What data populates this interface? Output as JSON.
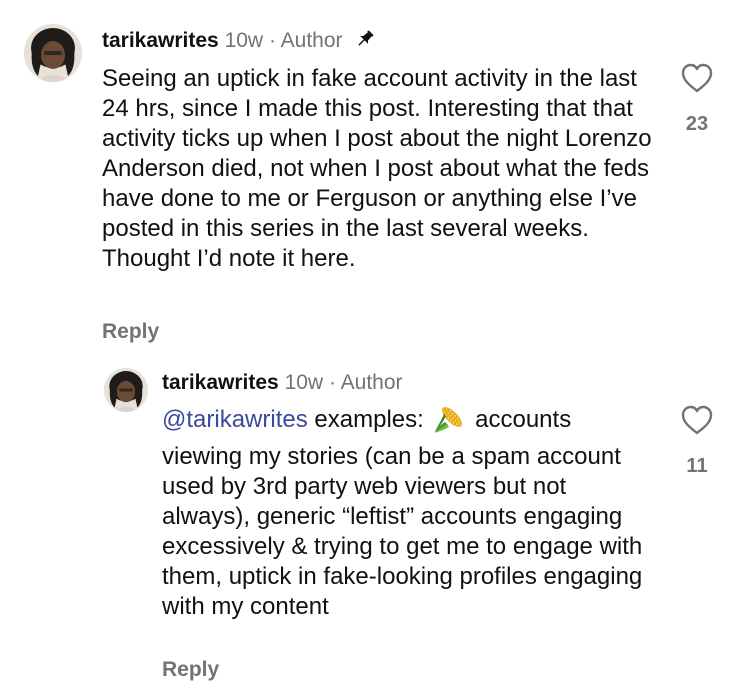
{
  "comments": [
    {
      "username": "tarikawrites",
      "time": "10w",
      "separator": "·",
      "role": "Author",
      "pinned": true,
      "pin_icon": "pin-icon",
      "text": "Seeing an uptick in fake account activity in the last 24 hrs, since I made this post. Interesting that that activity ticks up when I post about the night Lorenzo Anderson died, not when I post about what the feds have done to me or Ferguson or anything else I’ve posted in this series in the last several weeks. Thought I’d note it here.",
      "reply_label": "Reply",
      "like_icon": "heart-outline-icon",
      "like_count": "23"
    },
    {
      "username": "tarikawrites",
      "time": "10w",
      "separator": "·",
      "role": "Author",
      "mention": "@tarikawrites",
      "text_before_emoji": "examples:",
      "emoji_icon": "corn-emoji-icon",
      "text_after_emoji": "accounts viewing my stories (can be a spam account used by 3rd party web viewers but not always), generic “leftist” accounts engaging excessively & trying to get me to engage with them, uptick in fake-looking profiles engaging with my content",
      "reply_label": "Reply",
      "like_icon": "heart-outline-icon",
      "like_count": "11"
    }
  ],
  "colors": {
    "text": "#111111",
    "secondary": "#737373",
    "mention": "#3b4a9a",
    "background": "#ffffff"
  }
}
